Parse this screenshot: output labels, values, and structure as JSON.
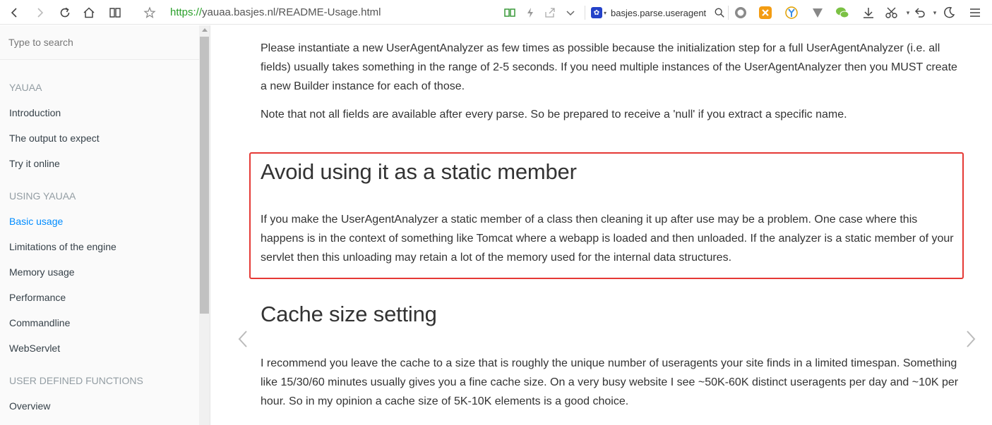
{
  "browser": {
    "url_proto": "https://",
    "url_rest": "yauaa.basjes.nl/README-Usage.html",
    "search_query": "basjes.parse.useragent"
  },
  "sidebar": {
    "search_placeholder": "Type to search",
    "sections": [
      {
        "header": "YAUAA",
        "items": [
          "Introduction",
          "The output to expect",
          "Try it online"
        ]
      },
      {
        "header": "USING YAUAA",
        "items": [
          "Basic usage",
          "Limitations of the engine",
          "Memory usage",
          "Performance",
          "Commandline",
          "WebServlet"
        ]
      },
      {
        "header": "USER DEFINED FUNCTIONS",
        "items": [
          "Overview"
        ]
      }
    ],
    "active_item": "Basic usage"
  },
  "content": {
    "intro_p1": "Please instantiate a new UserAgentAnalyzer as few times as possible because the initialization step for a full UserAgentAnalyzer (i.e. all fields) usually takes something in the range of 2-5 seconds. If you need multiple instances of the UserAgentAnalyzer then you MUST create a new Builder instance for each of those.",
    "intro_p2": "Note that not all fields are available after every parse. So be prepared to receive a 'null' if you extract a specific name.",
    "section1_title": "Avoid using it as a static member",
    "section1_body": "If you make the UserAgentAnalyzer a static member of a class then cleaning it up after use may be a problem. One case where this happens is in the context of something like Tomcat where a webapp is loaded and then unloaded. If the analyzer is a static member of your servlet then this unloading may retain a lot of the memory used for the internal data structures.",
    "section2_title": "Cache size setting",
    "section2_body": "I recommend you leave the cache to a size that is roughly the unique number of useragents your site finds in a limited timespan. Something like 15/30/60 minutes usually gives you a fine cache size. On a very busy website I see ~50K-60K distinct useragents per day and ~10K per hour. So in my opinion a cache size of 5K-10K elements is a good choice."
  },
  "colors": {
    "accent": "#008cff",
    "highlight_border": "#e53935",
    "url_proto": "#2aa02a"
  }
}
